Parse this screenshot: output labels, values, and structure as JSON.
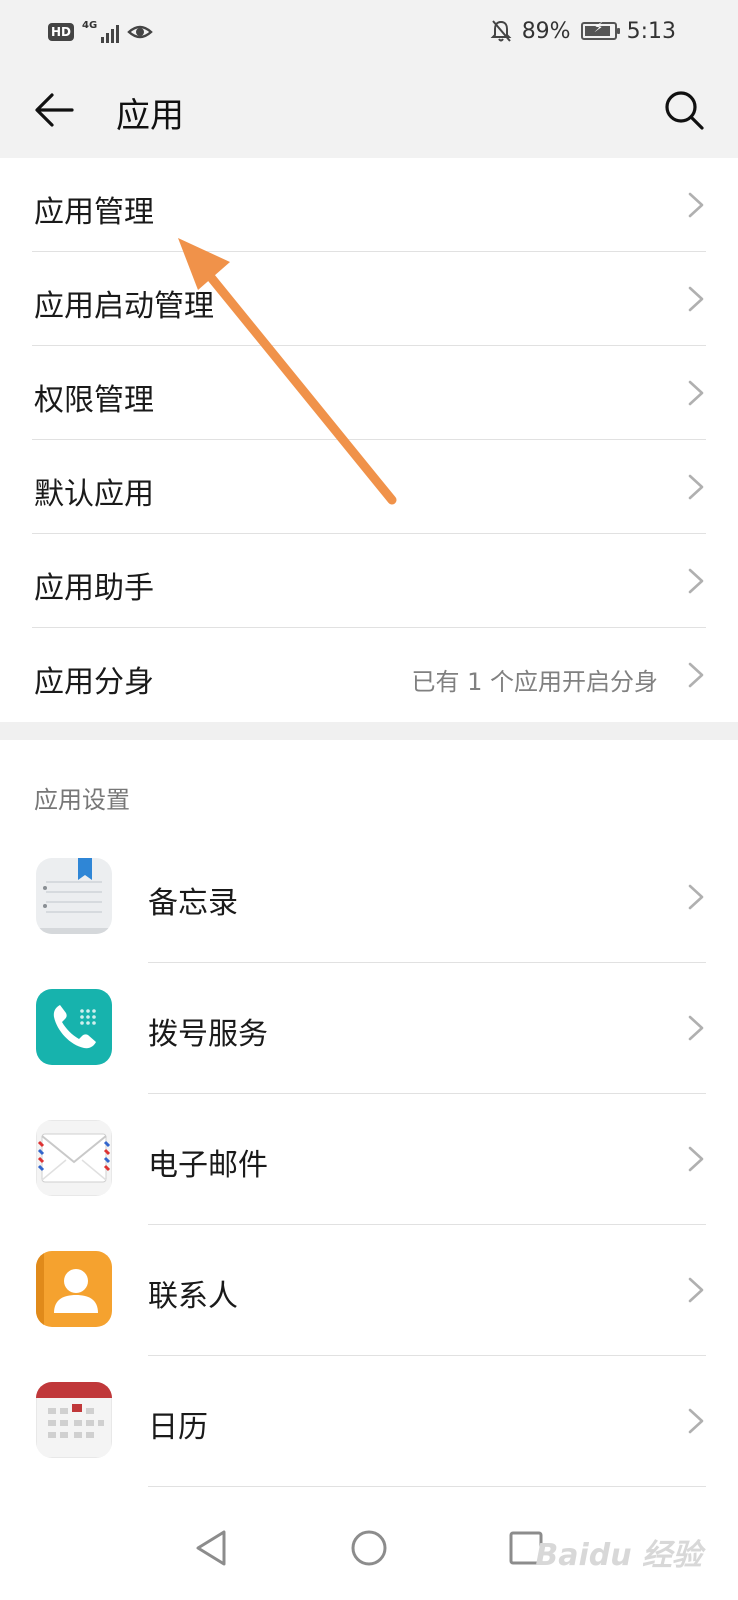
{
  "status_bar": {
    "hd": "HD",
    "network": "4G",
    "battery_percent": "89%",
    "battery_level": 0.89,
    "time": "5:13"
  },
  "header": {
    "title": "应用"
  },
  "menu": {
    "items": [
      {
        "label": "应用管理"
      },
      {
        "label": "应用启动管理"
      },
      {
        "label": "权限管理"
      },
      {
        "label": "默认应用"
      },
      {
        "label": "应用助手"
      },
      {
        "label": "应用分身",
        "value": "已有 1 个应用开启分身"
      }
    ]
  },
  "app_settings": {
    "title": "应用设置",
    "apps": [
      {
        "label": "备忘录",
        "icon": "notepad-icon"
      },
      {
        "label": "拨号服务",
        "icon": "phone-icon"
      },
      {
        "label": "电子邮件",
        "icon": "envelope-icon"
      },
      {
        "label": "联系人",
        "icon": "contact-icon"
      },
      {
        "label": "日历",
        "icon": "calendar-icon"
      }
    ]
  },
  "watermark": "Baidu 经验",
  "colors": {
    "annotation_arrow": "#f0924a",
    "phone_icon": "#17b3ad",
    "contacts_icon": "#f5a22f",
    "calendar_header": "#c0383a"
  }
}
